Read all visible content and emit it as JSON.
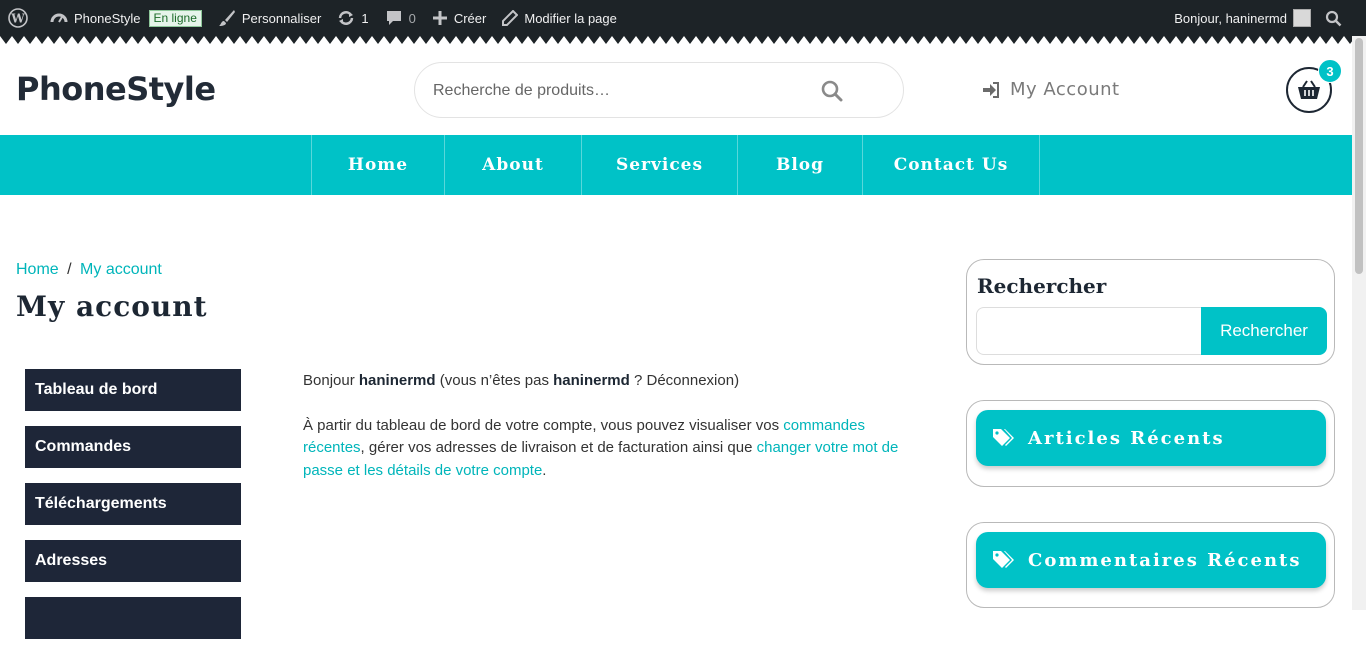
{
  "adminbar": {
    "site_name": "PhoneStyle",
    "status_badge": "En ligne",
    "customize": "Personnaliser",
    "updates_count": "1",
    "comments_count": "0",
    "new": "Créer",
    "edit_page": "Modifier la page",
    "greeting": "Bonjour, haninermd"
  },
  "header": {
    "logo": "PhoneStyle",
    "search_placeholder": "Recherche de produits…",
    "my_account": "My Account",
    "cart_count": "3"
  },
  "nav": {
    "items": [
      "Home",
      "About",
      "Services",
      "Blog",
      "Contact Us"
    ]
  },
  "breadcrumb": {
    "home": "Home",
    "separator": "/",
    "current": "My account"
  },
  "page_title": "My account",
  "account_nav": {
    "items": [
      "Tableau de bord",
      "Commandes",
      "Téléchargements",
      "Adresses"
    ]
  },
  "content": {
    "greeting_prefix": "Bonjour ",
    "username": "haninermd",
    "not_you_prefix": " (vous n’êtes pas ",
    "username2": "haninermd",
    "not_you_suffix": " ? ",
    "logout": "Déconnexion",
    "close_paren": ")",
    "dashboard_text_1": "À partir du tableau de bord de votre compte, vous pouvez visualiser vos ",
    "orders_link": "commandes récentes",
    "dashboard_text_2": ", gérer vos adresses de livraison et de facturation ainsi que ",
    "account_link": "changer votre mot de passe et les détails de votre compte",
    "dashboard_text_3": "."
  },
  "sidebar": {
    "search_title": "Rechercher",
    "search_button": "Rechercher",
    "recent_posts": "Articles Récents",
    "recent_comments": "Commentaires Récents"
  },
  "colors": {
    "accent": "#00c2c7",
    "dark": "#1e2638",
    "adminbar": "#1d2327"
  }
}
